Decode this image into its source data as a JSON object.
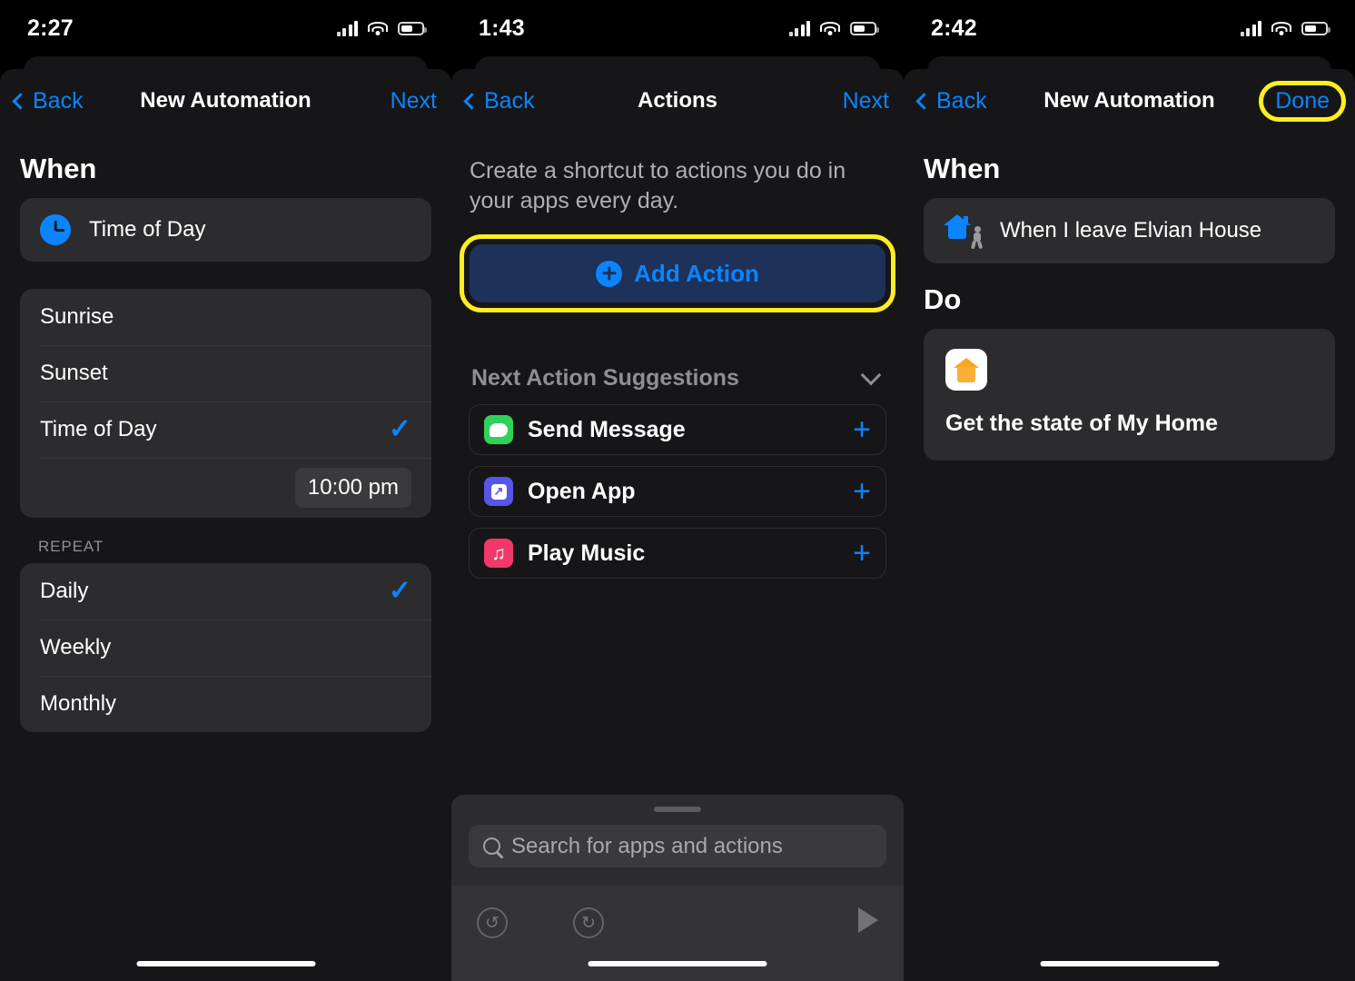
{
  "screens": [
    {
      "status": {
        "time": "2:27",
        "signal_icon": "cellular-bars-icon",
        "wifi_icon": "wifi-icon",
        "battery_icon": "battery-icon"
      },
      "nav": {
        "back_label": "Back",
        "title": "New Automation",
        "action_label": "Next",
        "action_highlighted": false
      },
      "when_header": "When",
      "trigger": {
        "icon": "clock-icon",
        "label": "Time of Day"
      },
      "options": [
        {
          "label": "Sunrise",
          "checked": false
        },
        {
          "label": "Sunset",
          "checked": false
        },
        {
          "label": "Time of Day",
          "checked": true
        }
      ],
      "time_value": "10:00 pm",
      "repeat_label": "REPEAT",
      "repeat_options": [
        {
          "label": "Daily",
          "checked": true
        },
        {
          "label": "Weekly",
          "checked": false
        },
        {
          "label": "Monthly",
          "checked": false
        }
      ],
      "checkmark": "✓"
    },
    {
      "status": {
        "time": "1:43",
        "signal_icon": "cellular-bars-icon",
        "wifi_icon": "wifi-icon",
        "battery_icon": "battery-icon"
      },
      "nav": {
        "back_label": "Back",
        "title": "Actions",
        "action_label": "Next",
        "action_highlighted": false
      },
      "intro": "Create a shortcut to actions you do in your apps every day.",
      "add_action": {
        "label": "Add Action",
        "icon": "plus-circle-icon",
        "highlighted": true,
        "highlight_color": "#fcee21",
        "fill": "#1e3159",
        "text_color": "#0a84ff"
      },
      "suggestions_header": "Next Action Suggestions",
      "suggestions": [
        {
          "label": "Send Message",
          "icon": "messages-app-icon",
          "color": "#30d158",
          "add_icon": "plus-icon"
        },
        {
          "label": "Open App",
          "icon": "open-app-icon",
          "color": "#5856e6",
          "add_icon": "plus-icon"
        },
        {
          "label": "Play Music",
          "icon": "music-app-icon",
          "color": "#f2376a",
          "add_icon": "plus-icon"
        }
      ],
      "search": {
        "placeholder": "Search for apps and actions",
        "icon": "search-icon"
      },
      "toolbar": {
        "undo_icon": "undo-icon",
        "redo_icon": "redo-icon",
        "play_icon": "play-icon",
        "undo_glyph": "↺",
        "redo_glyph": "↻"
      }
    },
    {
      "status": {
        "time": "2:42",
        "signal_icon": "cellular-bars-icon",
        "wifi_icon": "wifi-icon",
        "battery_icon": "battery-icon"
      },
      "nav": {
        "back_label": "Back",
        "title": "New Automation",
        "action_label": "Done",
        "action_highlighted": true,
        "highlight_color": "#fcee21"
      },
      "when_header": "When",
      "trigger": {
        "icon": "house-leave-icon",
        "label": "When I leave Elvian House"
      },
      "do_header": "Do",
      "do_action": {
        "icon": "home-app-icon",
        "label": "Get the state of My Home"
      }
    }
  ]
}
